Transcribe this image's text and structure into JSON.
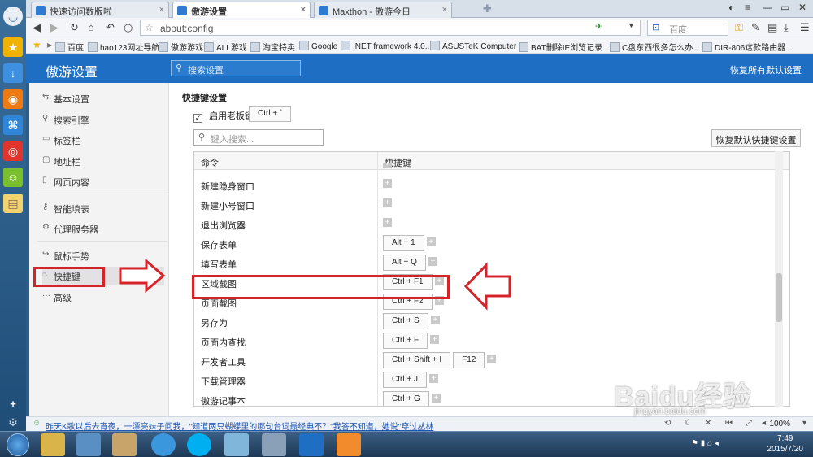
{
  "tabs": [
    {
      "label": "快速访问数版啦",
      "active": false
    },
    {
      "label": "傲游设置",
      "active": true
    },
    {
      "label": "Maxthon - 傲游今日",
      "active": false
    }
  ],
  "toolbar": {
    "address": "about:config",
    "search_placeholder": "百度"
  },
  "bookmarks": [
    "百度",
    "hao123网址导航",
    "傲游游戏",
    "ALL游戏",
    "淘宝特卖",
    "Google",
    ".NET framework 4.0...",
    "ASUSTeK Computer I...",
    "BAT删除IE浏览记录...",
    "C盘东西很多怎么办...",
    "DIR-806这款路由器..."
  ],
  "header": {
    "title": "傲游设置",
    "search_placeholder": "搜索设置",
    "restore_all": "恢复所有默认设置"
  },
  "sidenav": {
    "items": [
      {
        "label": "基本设置",
        "icon": "sliders-icon"
      },
      {
        "label": "搜索引擎",
        "icon": "search-icon"
      },
      {
        "label": "标签栏",
        "icon": "tab-icon"
      },
      {
        "label": "地址栏",
        "icon": "address-icon"
      },
      {
        "label": "网页内容",
        "icon": "page-icon"
      },
      {
        "label": "智能填表",
        "icon": "key-icon"
      },
      {
        "label": "代理服务器",
        "icon": "proxy-icon"
      },
      {
        "label": "鼠标手势",
        "icon": "mouse-icon"
      },
      {
        "label": "快捷键",
        "icon": "hand-icon"
      },
      {
        "label": "高级",
        "icon": "more-icon"
      }
    ],
    "active": "快捷键"
  },
  "shortcuts": {
    "section_title": "快捷键设置",
    "boss_key_label": "启用老板键",
    "boss_key_value": "Ctrl + `",
    "filter_placeholder": "键入搜索...",
    "restore_button": "恢复默认快捷键设置",
    "col_command": "命令",
    "col_shortcut": "快捷键",
    "rows": [
      {
        "cmd": "新建隐身窗口",
        "keys": []
      },
      {
        "cmd": "新建小号窗口",
        "keys": []
      },
      {
        "cmd": "退出浏览器",
        "keys": []
      },
      {
        "cmd": "保存表单",
        "keys": [
          "Alt + 1"
        ]
      },
      {
        "cmd": "填写表单",
        "keys": [
          "Alt + Q"
        ]
      },
      {
        "cmd": "区域截图",
        "keys": [
          "Ctrl + F1"
        ]
      },
      {
        "cmd": "页面截图",
        "keys": [
          "Ctrl + F2"
        ]
      },
      {
        "cmd": "另存为",
        "keys": [
          "Ctrl + S"
        ]
      },
      {
        "cmd": "页面内查找",
        "keys": [
          "Ctrl + F"
        ]
      },
      {
        "cmd": "开发者工具",
        "keys": [
          "Ctrl + Shift + I",
          "F12"
        ]
      },
      {
        "cmd": "下载管理器",
        "keys": [
          "Ctrl + J"
        ]
      },
      {
        "cmd": "傲游记事本",
        "keys": [
          "Ctrl + G"
        ]
      }
    ],
    "highlighted": "区域截图"
  },
  "statusbar": {
    "news": "昨天K歌以后去宵夜，一漂亮妹子问我，\"知道两只蝴蝶里的哪句台词最经典不？\"我答不知道，她说\"穿过丛林",
    "zoom": "100%"
  },
  "taskbar": {
    "time": "7:49",
    "date": "2015/7/20"
  },
  "watermark": {
    "text": "Baidu经验",
    "url": "jingyan.baidu.com"
  },
  "colors": {
    "header": "#1e6fc4",
    "annotation": "#d4242a"
  }
}
